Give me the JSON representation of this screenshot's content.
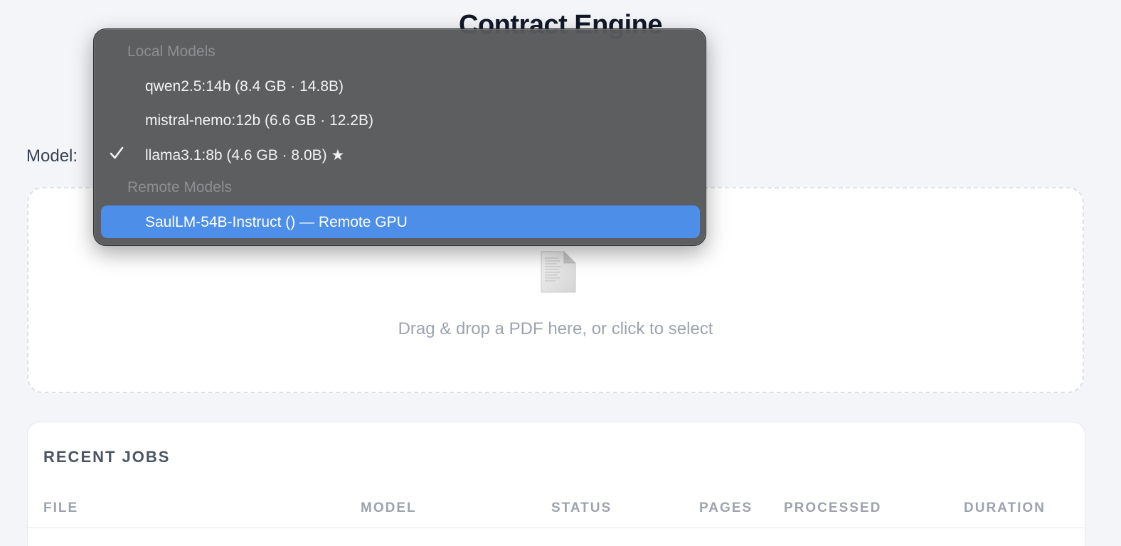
{
  "page": {
    "title": "Contract Engine",
    "subtitle": ""
  },
  "model_selector": {
    "label": "Model:",
    "selected": "llama3.1:8b (4.6 GB · 8.0B) ★"
  },
  "dropdown": {
    "groups": [
      {
        "header": "Local Models",
        "options": [
          {
            "label": "qwen2.5:14b (8.4 GB · 14.8B)",
            "checked": false,
            "highlighted": false
          },
          {
            "label": "mistral-nemo:12b (6.6 GB · 12.2B)",
            "checked": false,
            "highlighted": false
          },
          {
            "label": "llama3.1:8b (4.6 GB · 8.0B) ★",
            "checked": true,
            "highlighted": false
          }
        ]
      },
      {
        "header": "Remote Models",
        "options": [
          {
            "label": "SaulLM-54B-Instruct () — Remote GPU",
            "checked": false,
            "highlighted": true
          }
        ]
      }
    ]
  },
  "dropzone": {
    "text": "Drag & drop a PDF here, or click to select",
    "icon": "document-icon"
  },
  "jobs": {
    "title": "RECENT JOBS",
    "columns": [
      "FILE",
      "MODEL",
      "STATUS",
      "PAGES",
      "PROCESSED",
      "DURATION"
    ]
  },
  "colors": {
    "background": "#f4f5f9",
    "menu_bg": "#58595b",
    "highlight": "#4c8ee8"
  }
}
